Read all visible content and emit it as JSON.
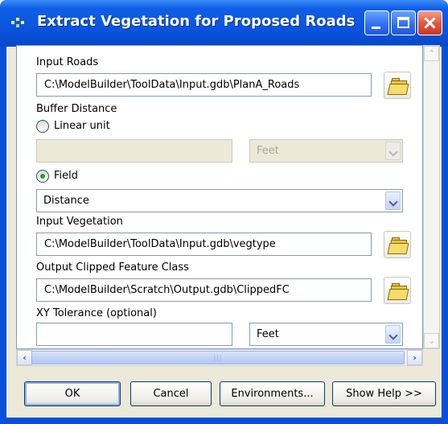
{
  "window": {
    "title": "Extract Vegetation for Proposed Roads"
  },
  "form": {
    "input_roads": {
      "label": "Input Roads",
      "value": "C:\\ModelBuilder\\ToolData\\Input.gdb\\PlanA_Roads"
    },
    "buffer_distance": {
      "label": "Buffer Distance",
      "linear_unit_label": "Linear unit",
      "linear_unit_value": "",
      "linear_unit_units": "Feet",
      "field_label": "Field",
      "field_value": "Distance",
      "selected": "field"
    },
    "input_vegetation": {
      "label": "Input Vegetation",
      "value": "C:\\ModelBuilder\\ToolData\\Input.gdb\\vegtype"
    },
    "output_feature_class": {
      "label": "Output Clipped Feature Class",
      "value": "C:\\ModelBuilder\\Scratch\\Output.gdb\\ClippedFC"
    },
    "xy_tolerance": {
      "label": "XY Tolerance (optional)",
      "value": "",
      "units": "Feet"
    }
  },
  "buttons": {
    "ok": "OK",
    "cancel": "Cancel",
    "environments": "Environments...",
    "show_help": "Show Help >>"
  },
  "icons": {
    "app": "toolbox-model-icon",
    "browse": "open-folder-icon",
    "minimize": "minimize-icon",
    "maximize": "maximize-icon",
    "close": "close-icon"
  },
  "colors": {
    "titlebar": "#0a55df",
    "dialog_bg": "#ece9d8",
    "close_button": "#e2553a",
    "radio_dot": "#21a121"
  }
}
